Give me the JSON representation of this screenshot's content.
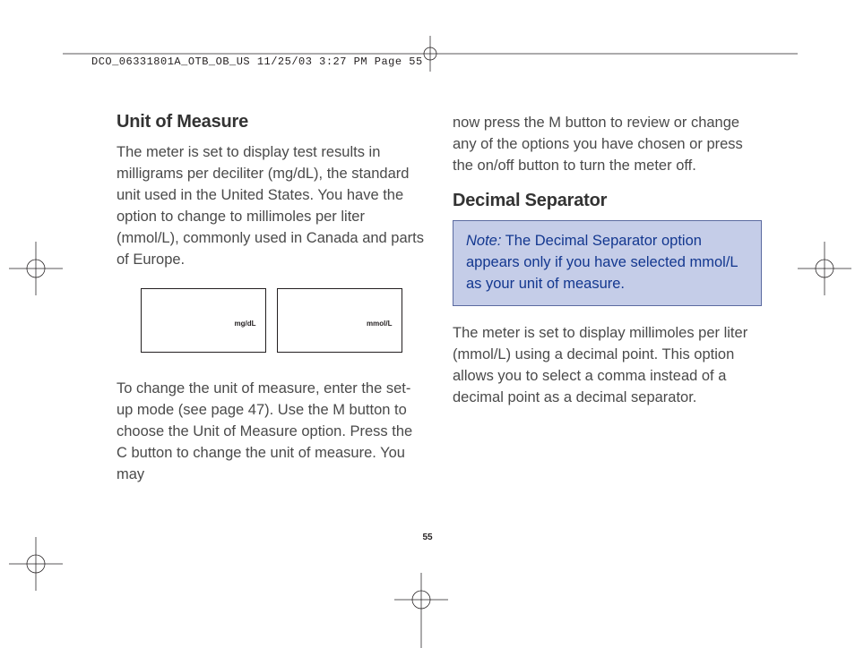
{
  "header": "DCO_06331801A_OTB_OB_US  11/25/03  3:27 PM  Page 55",
  "left": {
    "heading": "Unit of Measure",
    "p1": "The meter is set to display test results in milligrams per deciliter (mg/dL), the standard unit used in the United States. You have the option to change to millimoles per liter (mmol/L), commonly used in Canada and parts of Europe.",
    "screen1": "mg/dL",
    "screen2": "mmol/L",
    "p2": "To change the unit of measure, enter the set-up mode (see page 47). Use the M button to choose the Unit of Measure option. Press the C button to change the unit of measure. You may"
  },
  "right": {
    "p_cont": "now press the M button to review or change any of the options you have chosen or press the on/off button to turn the meter off.",
    "heading": "Decimal Separator",
    "note_label": "Note:",
    "note_body": " The Decimal Separator option appears only if you have selected mmol/L as your unit of measure.",
    "p2": "The meter is set to display millimoles per liter (mmol/L) using a decimal point. This option allows you to select a comma instead of a decimal point as a decimal separator."
  },
  "page_number": "55"
}
